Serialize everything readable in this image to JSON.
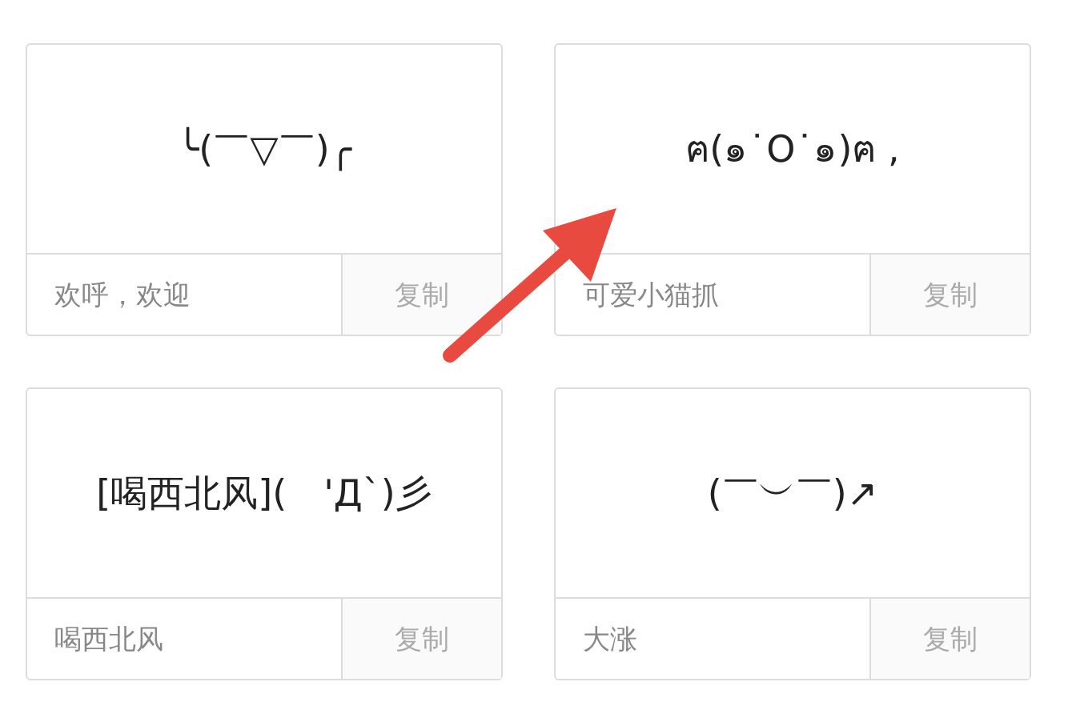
{
  "cards": [
    {
      "emoticon": "╰(￣▽￣)╭",
      "label": "欢呼，欢迎",
      "button": "复制"
    },
    {
      "emoticon": "ฅ(๑˙O˙๑)ฅ ,",
      "label": "可爱小猫抓",
      "button": "复制"
    },
    {
      "emoticon": "[喝西北风](　'Д`)彡",
      "label": "喝西北风",
      "button": "复制"
    },
    {
      "emoticon": "(￣︶￣)↗",
      "label": "大涨",
      "button": "复制"
    }
  ]
}
